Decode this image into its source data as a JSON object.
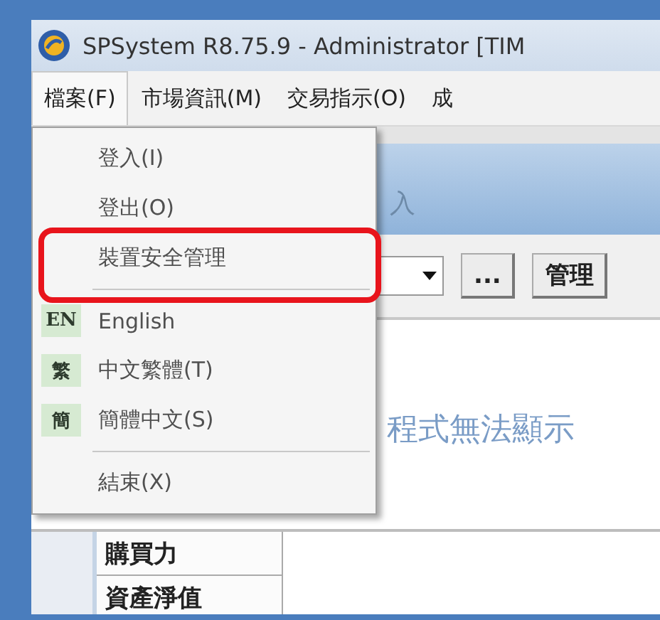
{
  "window": {
    "title": "SPSystem R8.75.9 - Administrator [TIM"
  },
  "menu_bar": [
    {
      "label": "檔案(F)",
      "selected": true
    },
    {
      "label": "市場資訊(M)",
      "selected": false
    },
    {
      "label": "交易指示(O)",
      "selected": false
    },
    {
      "label": "成",
      "selected": false
    }
  ],
  "file_menu": [
    {
      "kind": "item",
      "label": "登入(I)"
    },
    {
      "kind": "item",
      "label": "登出(O)"
    },
    {
      "kind": "item",
      "label": "裝置安全管理",
      "highlighted": true
    },
    {
      "kind": "separator"
    },
    {
      "kind": "item",
      "label": "English",
      "badge": "EN"
    },
    {
      "kind": "item",
      "label": "中文繁體(T)",
      "badge": "繁"
    },
    {
      "kind": "item",
      "label": "簡體中文(S)",
      "badge": "簡"
    },
    {
      "kind": "separator"
    },
    {
      "kind": "item",
      "label": "結束(X)"
    }
  ],
  "panel": {
    "header": "入",
    "browse_button": "...",
    "manage_button": "管理",
    "message": "程式無法顯示"
  },
  "side_cells": [
    "購買力",
    "資產淨值"
  ]
}
